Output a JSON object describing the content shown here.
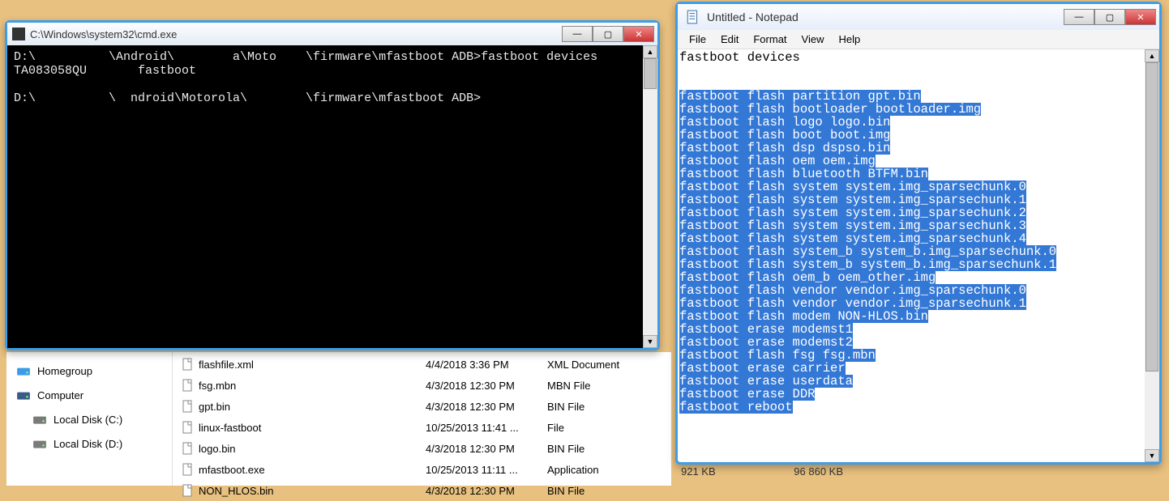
{
  "explorer": {
    "nav": [
      {
        "label": "Homegroup",
        "iconColor": "#3a9be8"
      },
      {
        "label": "Computer",
        "iconColor": "#3a5a88"
      },
      {
        "label": "Local Disk (C:)",
        "iconColor": "#7a7a7a",
        "indent": true
      },
      {
        "label": "Local Disk (D:)",
        "iconColor": "#7a7a7a",
        "indent": true
      }
    ],
    "files": [
      {
        "name": "flashfile.xml",
        "date": "4/4/2018 3:36 PM",
        "type": "XML Document"
      },
      {
        "name": "fsg.mbn",
        "date": "4/3/2018 12:30 PM",
        "type": "MBN File"
      },
      {
        "name": "gpt.bin",
        "date": "4/3/2018 12:30 PM",
        "type": "BIN File"
      },
      {
        "name": "linux-fastboot",
        "date": "10/25/2013 11:41 ...",
        "type": "File"
      },
      {
        "name": "logo.bin",
        "date": "4/3/2018 12:30 PM",
        "type": "BIN File"
      },
      {
        "name": "mfastboot.exe",
        "date": "10/25/2013 11:11 ...",
        "type": "Application"
      },
      {
        "name": "NON_HLOS.bin",
        "date": "4/3/2018 12:30 PM",
        "type": "BIN File"
      }
    ],
    "extra": {
      "size1": "921 KB",
      "size2": "96 860 KB"
    }
  },
  "cmd": {
    "title": "C:\\Windows\\system32\\cmd.exe",
    "lines": [
      "D:\\          \\Android\\        a\\Moto    \\firmware\\mfastboot ADB>fastboot devices",
      "TA083058QU       fastboot",
      "",
      "D:\\          \\  ndroid\\Motorola\\        \\firmware\\mfastboot ADB>"
    ]
  },
  "notepad": {
    "title": "Untitled - Notepad",
    "menus": [
      "File",
      "Edit",
      "Format",
      "View",
      "Help"
    ],
    "plain_lines": [
      "fastboot devices",
      ""
    ],
    "selected_lines": [
      "fastboot flash partition gpt.bin",
      "fastboot flash bootloader bootloader.img",
      "fastboot flash logo logo.bin",
      "fastboot flash boot boot.img",
      "fastboot flash dsp dspso.bin",
      "fastboot flash oem oem.img",
      "fastboot flash bluetooth BTFM.bin",
      "fastboot flash system system.img_sparsechunk.0",
      "fastboot flash system system.img_sparsechunk.1",
      "fastboot flash system system.img_sparsechunk.2",
      "fastboot flash system system.img_sparsechunk.3",
      "fastboot flash system system.img_sparsechunk.4",
      "fastboot flash system_b system_b.img_sparsechunk.0",
      "fastboot flash system_b system_b.img_sparsechunk.1",
      "fastboot flash oem_b oem_other.img",
      "fastboot flash vendor vendor.img_sparsechunk.0",
      "fastboot flash vendor vendor.img_sparsechunk.1",
      "fastboot flash modem NON-HLOS.bin",
      "fastboot erase modemst1",
      "fastboot erase modemst2",
      "fastboot flash fsg fsg.mbn",
      "fastboot erase carrier",
      "fastboot erase userdata",
      "fastboot erase DDR",
      "fastboot reboot"
    ]
  },
  "win_controls": {
    "min": "—",
    "max": "▢",
    "close": "✕"
  }
}
